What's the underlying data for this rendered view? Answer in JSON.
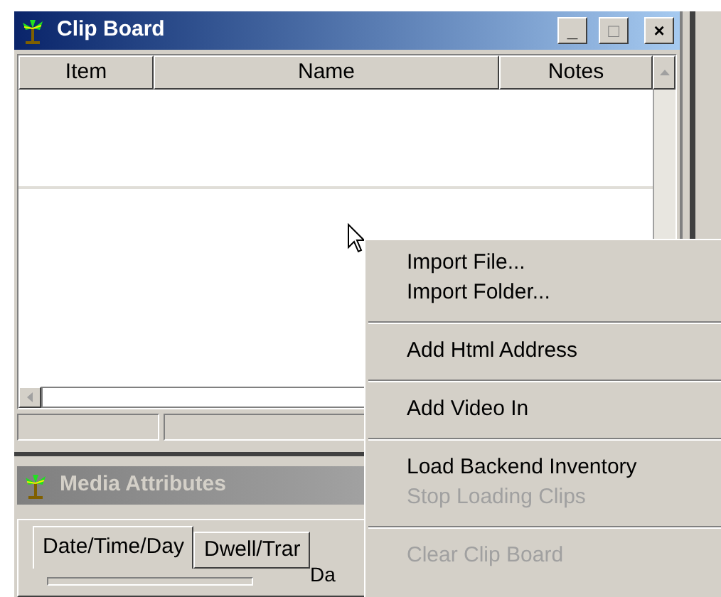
{
  "clip_board": {
    "title": "Clip Board",
    "controls": [
      "_",
      "□",
      "×"
    ],
    "columns": [
      "Item",
      "Name",
      "Notes"
    ]
  },
  "media_attributes": {
    "title": "Media Attributes",
    "active": false,
    "tabs": [
      {
        "label": "Date/Time/Day",
        "selected": true
      },
      {
        "label": "Dwell/Trar",
        "selected": false
      }
    ],
    "field_label": "Da"
  },
  "context_menu": [
    {
      "kind": "item",
      "label": "Import File...",
      "disabled": false
    },
    {
      "kind": "item",
      "label": "Import Folder...",
      "disabled": false
    },
    {
      "kind": "separator"
    },
    {
      "kind": "item",
      "label": "Add Html Address",
      "disabled": false
    },
    {
      "kind": "separator"
    },
    {
      "kind": "item",
      "label": "Add Video In",
      "disabled": false
    },
    {
      "kind": "separator"
    },
    {
      "kind": "item",
      "label": "Load Backend Inventory",
      "disabled": false
    },
    {
      "kind": "item",
      "label": "Stop Loading Clips",
      "disabled": true
    },
    {
      "kind": "separator"
    },
    {
      "kind": "item",
      "label": "Clear Clip Board",
      "disabled": true
    }
  ]
}
